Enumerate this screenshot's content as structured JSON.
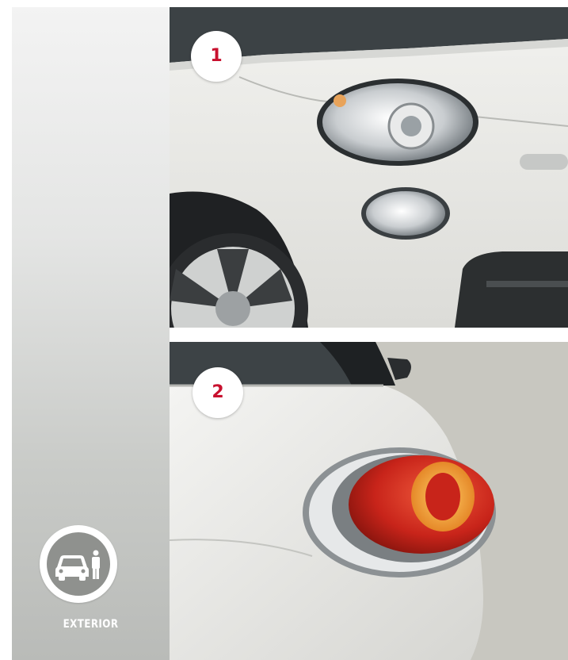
{
  "sidebar": {
    "badge_icon": "car-and-person-icon",
    "badge_label": "EXTERIOR"
  },
  "photos": [
    {
      "number": "1",
      "subject": "front-headlight-photo"
    },
    {
      "number": "2",
      "subject": "rear-taillight-photo"
    }
  ],
  "colors": {
    "accent": "#c8102e",
    "badge_gray": "#8f918e"
  }
}
